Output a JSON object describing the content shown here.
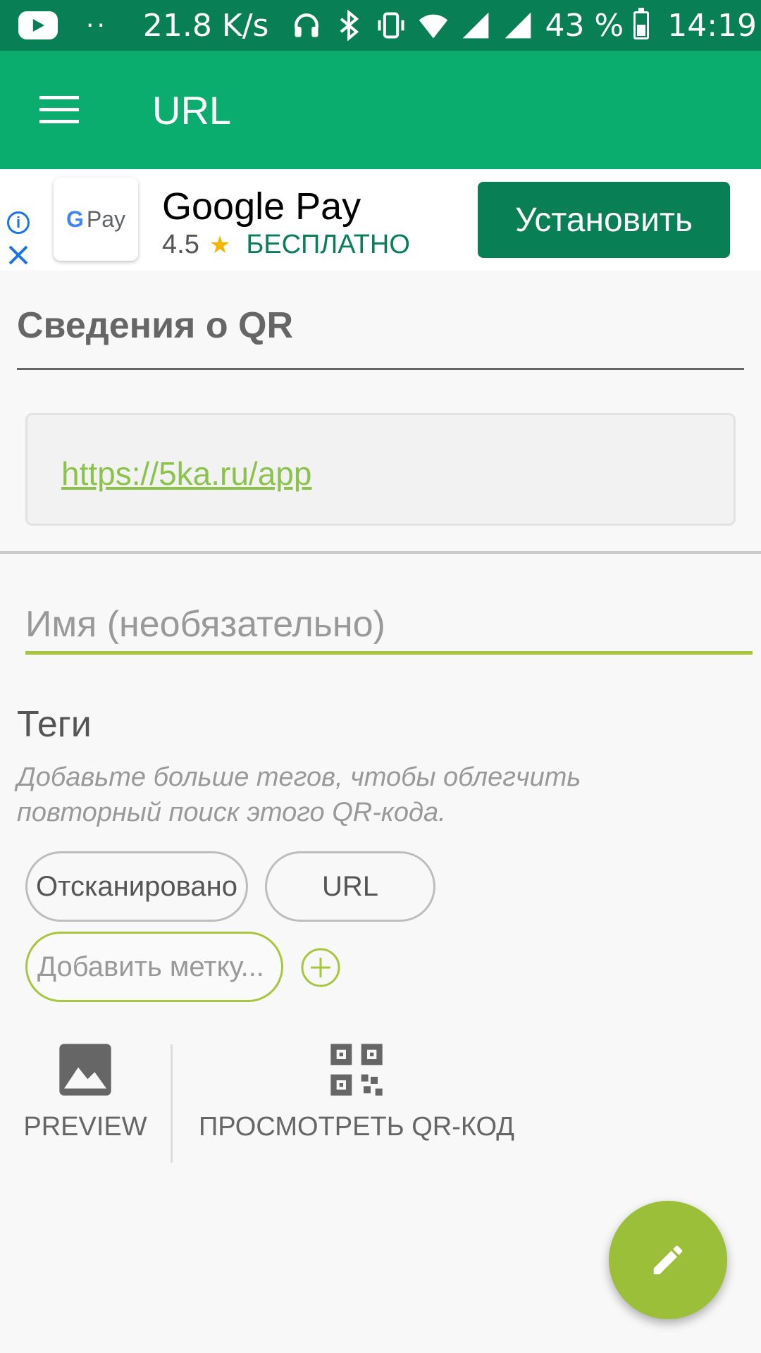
{
  "status_bar": {
    "net_speed": "21.8 K/s",
    "battery_percent": "43 %",
    "time": "14:19",
    "icons": [
      "youtube-icon",
      "more-dots-icon",
      "headphones-icon",
      "bluetooth-icon",
      "vibrate-icon",
      "wifi-icon",
      "signal-icon",
      "signal-icon",
      "battery-icon"
    ]
  },
  "app_bar": {
    "title": "URL",
    "menu_icon": "hamburger-menu-icon"
  },
  "ad": {
    "logo_text": "Pay",
    "logo_g": "G",
    "title": "Google Pay",
    "rating": "4.5",
    "price": "БЕСПЛАТНО",
    "install_label": "Установить",
    "info_icon": "i"
  },
  "details": {
    "section_title": "Сведения о QR",
    "url": "https://5ka.ru/app"
  },
  "name_field": {
    "placeholder": "Имя (необязательно)"
  },
  "tags": {
    "title": "Теги",
    "hint": "Добавьте больше тегов, чтобы облегчить повторный поиск этого QR-кода.",
    "chips": [
      "Отсканировано",
      "URL"
    ],
    "add_placeholder": "Добавить метку..."
  },
  "actions": {
    "preview_label": "PREVIEW",
    "view_qr_label": "ПРОСМОТРЕТЬ QR-КОД"
  },
  "colors": {
    "status_bar": "#087f55",
    "app_bar": "#0aad6e",
    "accent": "#a6c63b",
    "fab": "#9cbf3a",
    "link": "#8bc34a"
  }
}
